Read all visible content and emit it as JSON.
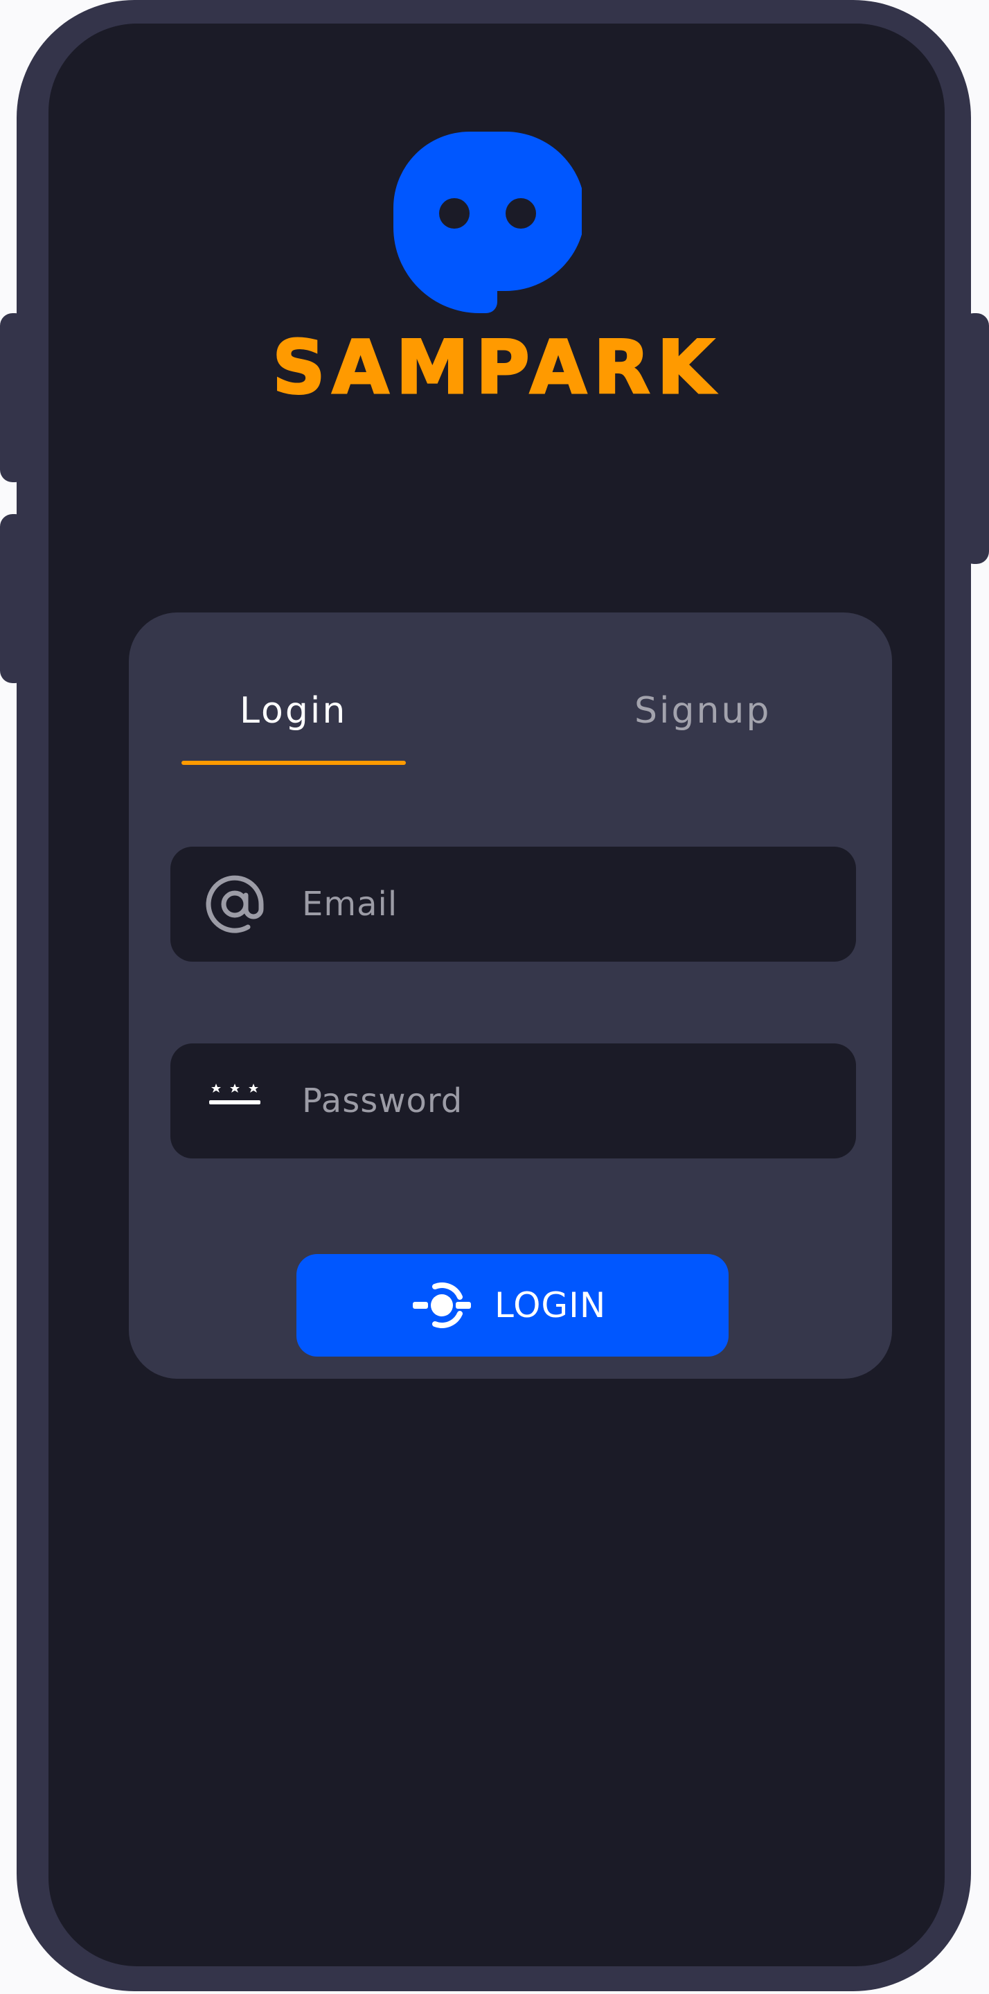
{
  "app": {
    "brand_name": "SAMPARK"
  },
  "auth": {
    "tabs": [
      {
        "label": "Login",
        "active": true
      },
      {
        "label": "Signup",
        "active": false
      }
    ],
    "email": {
      "placeholder": "Email",
      "value": "",
      "icon": "at-sign-icon"
    },
    "password": {
      "placeholder": "Password",
      "value": "",
      "icon": "password-icon"
    },
    "submit": {
      "label": "LOGIN",
      "icon": "login-icon"
    }
  },
  "colors": {
    "accent": "#ff9a00",
    "primary": "#0057ff",
    "screen_bg": "#1b1b27",
    "card_bg": "#36374b",
    "frame": "#34344a"
  }
}
